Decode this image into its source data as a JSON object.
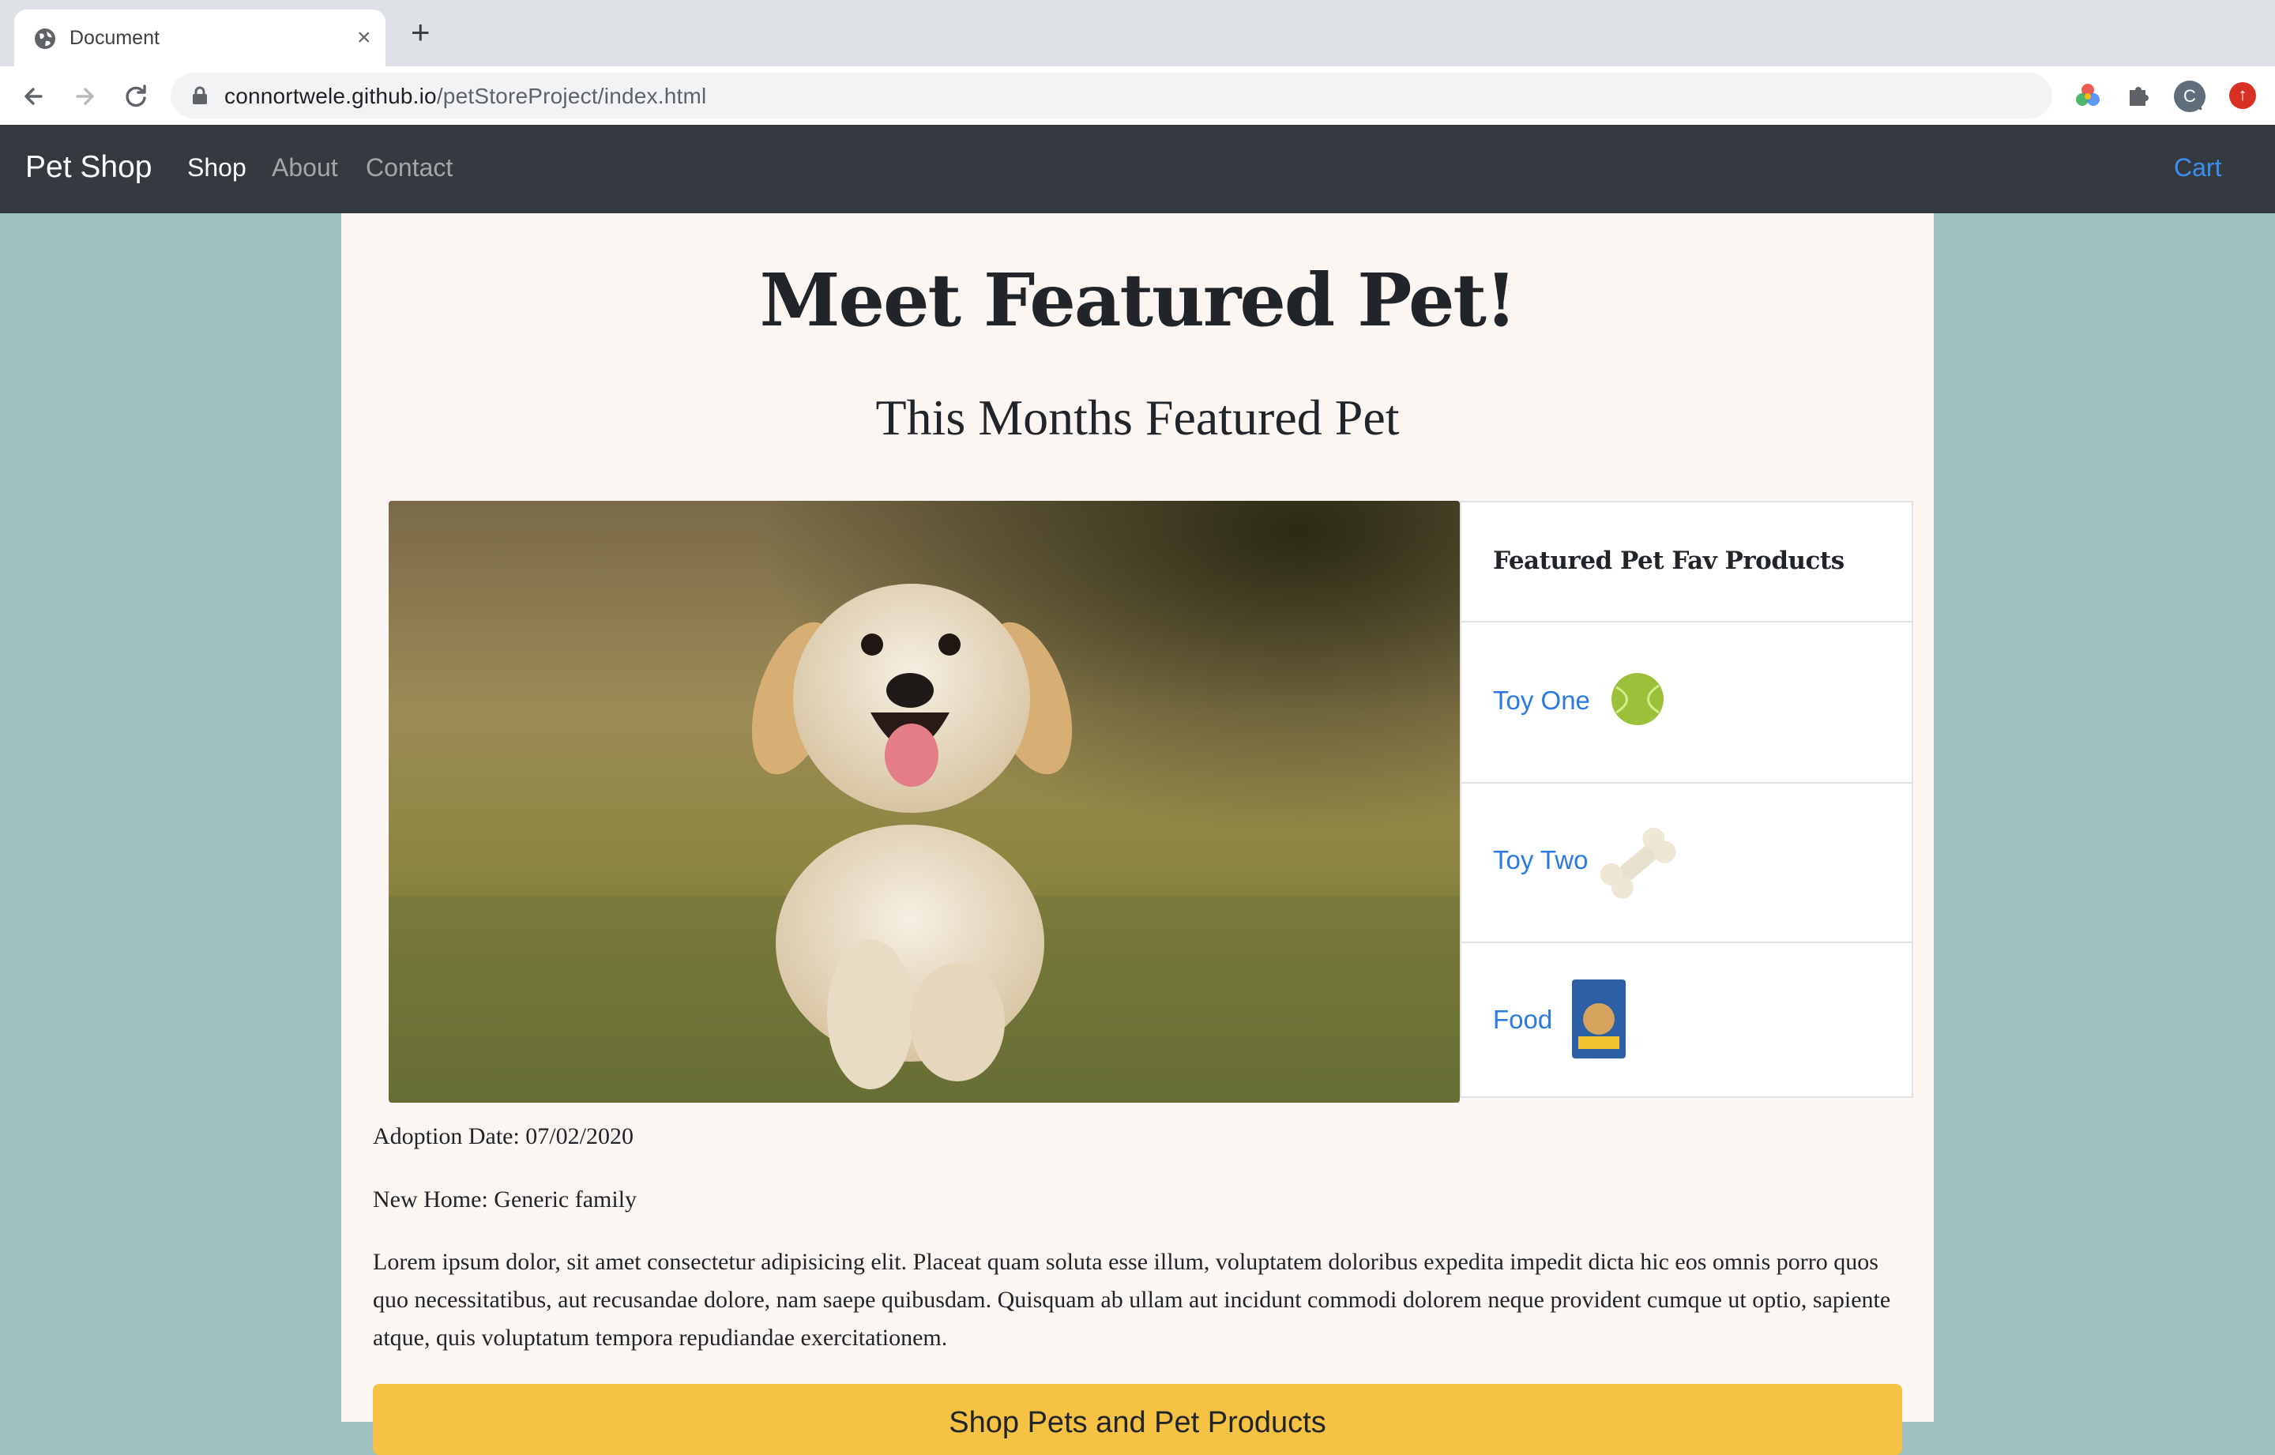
{
  "browser": {
    "tab_title": "Document",
    "url_host": "connortwele.github.io",
    "url_path": "/petStoreProject/index.html",
    "profile_initial": "C"
  },
  "navbar": {
    "brand": "Pet Shop",
    "links": [
      "Shop",
      "About",
      "Contact"
    ],
    "active": "Shop",
    "cart": "Cart"
  },
  "page": {
    "title": "Meet Featured Pet!",
    "subtitle": "This Months Featured Pet",
    "products_header": "Featured Pet Fav Products",
    "products": [
      {
        "label": "Toy One",
        "icon": "tennis-ball-icon"
      },
      {
        "label": "Toy Two",
        "icon": "bone-icon"
      },
      {
        "label": "Food",
        "icon": "dog-food-bag-icon"
      }
    ],
    "adoption_date": "Adoption Date: 07/02/2020",
    "new_home": "New Home: Generic family",
    "description": "Lorem ipsum dolor, sit amet consectetur adipisicing elit. Placeat quam soluta esse illum, voluptatem doloribus expedita impedit dicta hic eos omnis porro quos quo necessitatibus, aut recusandae dolore, nam saepe quibusdam. Quisquam ab ullam aut incidunt commodi dolorem neque provident cumque ut optio, sapiente atque, quis voluptatum tempora repudiandae exercitationem.",
    "shop_button": "Shop Pets and Pet Products"
  },
  "colors": {
    "page_bg": "#9fc2c0",
    "navbar_bg": "#343a40",
    "content_bg": "#fbf6f2",
    "link": "#2a7ae2",
    "button": "#f6c244"
  }
}
